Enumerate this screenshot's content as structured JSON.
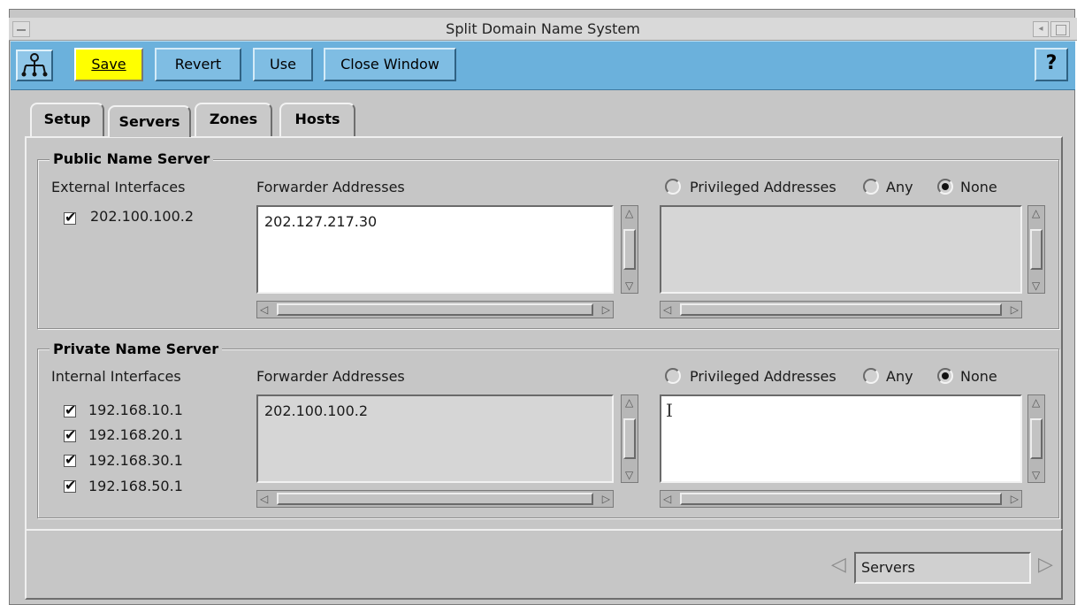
{
  "window": {
    "title": "Split Domain Name System"
  },
  "toolbar": {
    "save_label": "Save",
    "revert_label": "Revert",
    "use_label": "Use",
    "close_label": "Close Window",
    "help_label": "?",
    "save_color": "#ffff00",
    "bar_color": "#6bb1dc"
  },
  "tabs": [
    {
      "label": "Setup",
      "active": false
    },
    {
      "label": "Servers",
      "active": true
    },
    {
      "label": "Zones",
      "active": false
    },
    {
      "label": "Hosts",
      "active": false
    }
  ],
  "public_server": {
    "title": "Public Name Server",
    "interfaces_label": "External Interfaces",
    "interfaces": [
      {
        "address": "202.100.100.2",
        "checked": true
      }
    ],
    "forwarder_label": "Forwarder Addresses",
    "forwarder_value": "202.127.217.30",
    "privileged_label": "Privileged Addresses",
    "any_label": "Any",
    "none_label": "None",
    "selected_option": "None"
  },
  "private_server": {
    "title": "Private Name Server",
    "interfaces_label": "Internal Interfaces",
    "interfaces": [
      {
        "address": "192.168.10.1",
        "checked": true
      },
      {
        "address": "192.168.20.1",
        "checked": true
      },
      {
        "address": "192.168.30.1",
        "checked": true
      },
      {
        "address": "192.168.50.1",
        "checked": true
      }
    ],
    "forwarder_label": "Forwarder Addresses",
    "forwarder_value": "202.100.100.2",
    "privileged_label": "Privileged Addresses",
    "any_label": "Any",
    "none_label": "None",
    "selected_option": "None"
  },
  "nav": {
    "current": "Servers"
  }
}
